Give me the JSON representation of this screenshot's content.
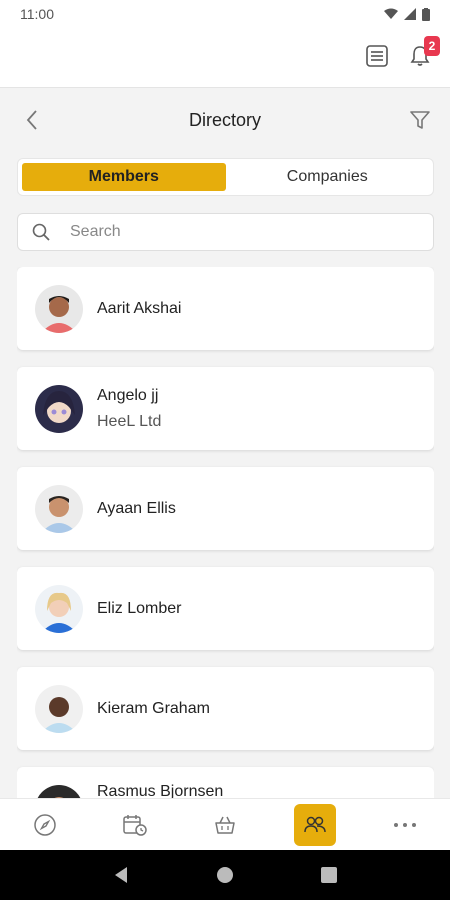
{
  "status": {
    "time": "11:00"
  },
  "topbar": {
    "notification_count": "2",
    "icons": [
      "list-icon",
      "bell-icon"
    ]
  },
  "header": {
    "title": "Directory"
  },
  "tabs": [
    {
      "label": "Members",
      "active": true
    },
    {
      "label": "Companies",
      "active": false
    }
  ],
  "search": {
    "placeholder": "Search",
    "value": ""
  },
  "members": [
    {
      "name": "Aarit Akshai",
      "company": ""
    },
    {
      "name": "Angelo jj",
      "company": "HeeL Ltd"
    },
    {
      "name": "Ayaan Ellis",
      "company": ""
    },
    {
      "name": "Eliz Lomber",
      "company": ""
    },
    {
      "name": "Kieram Graham",
      "company": ""
    },
    {
      "name": "Rasmus Bjornsen",
      "company": ""
    }
  ],
  "bottom_nav": [
    {
      "icon": "compass-icon",
      "active": false
    },
    {
      "icon": "calendar-clock-icon",
      "active": false
    },
    {
      "icon": "basket-icon",
      "active": false
    },
    {
      "icon": "people-icon",
      "active": true
    },
    {
      "icon": "more-icon",
      "active": false
    }
  ],
  "colors": {
    "accent": "#e6ad0c",
    "badge": "#e8384f"
  }
}
